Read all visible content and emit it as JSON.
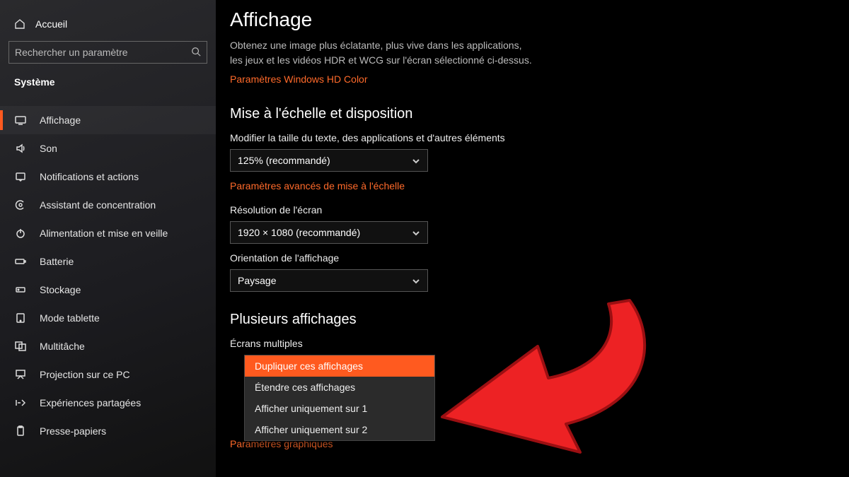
{
  "sidebar": {
    "home": "Accueil",
    "search_placeholder": "Rechercher un paramètre",
    "section": "Système",
    "items": [
      {
        "icon": "display-icon",
        "label": "Affichage",
        "active": true
      },
      {
        "icon": "sound-icon",
        "label": "Son"
      },
      {
        "icon": "notifications-icon",
        "label": "Notifications et actions"
      },
      {
        "icon": "focus-icon",
        "label": "Assistant de concentration"
      },
      {
        "icon": "power-icon",
        "label": "Alimentation et mise en veille"
      },
      {
        "icon": "battery-icon",
        "label": "Batterie"
      },
      {
        "icon": "storage-icon",
        "label": "Stockage"
      },
      {
        "icon": "tablet-icon",
        "label": "Mode tablette"
      },
      {
        "icon": "multitask-icon",
        "label": "Multitâche"
      },
      {
        "icon": "projection-icon",
        "label": "Projection sur ce PC"
      },
      {
        "icon": "shared-icon",
        "label": "Expériences partagées"
      },
      {
        "icon": "clipboard-icon",
        "label": "Presse-papiers"
      }
    ]
  },
  "page": {
    "title": "Affichage",
    "subtitle_line1": "Obtenez une image plus éclatante, plus vive dans les applications,",
    "subtitle_line2": "les jeux et les vidéos HDR et WCG sur l'écran sélectionné ci-dessus.",
    "hd_link": "Paramètres Windows HD Color",
    "scale_heading": "Mise à l'échelle et disposition",
    "scale_label": "Modifier la taille du texte, des applications et d'autres éléments",
    "scale_value": "125% (recommandé)",
    "scale_adv_link": "Paramètres avancés de mise à l'échelle",
    "res_label": "Résolution de l'écran",
    "res_value": "1920 × 1080 (recommandé)",
    "orient_label": "Orientation de l'affichage",
    "orient_value": "Paysage",
    "multi_heading": "Plusieurs affichages",
    "multi_label": "Écrans multiples",
    "multi_options": [
      "Dupliquer ces affichages",
      "Étendre ces affichages",
      "Afficher uniquement sur 1",
      "Afficher uniquement sur 2"
    ],
    "hidden_link": "Paramètres graphiques"
  },
  "colors": {
    "accent": "#ff5a1f",
    "arrow": "#ed2224"
  }
}
